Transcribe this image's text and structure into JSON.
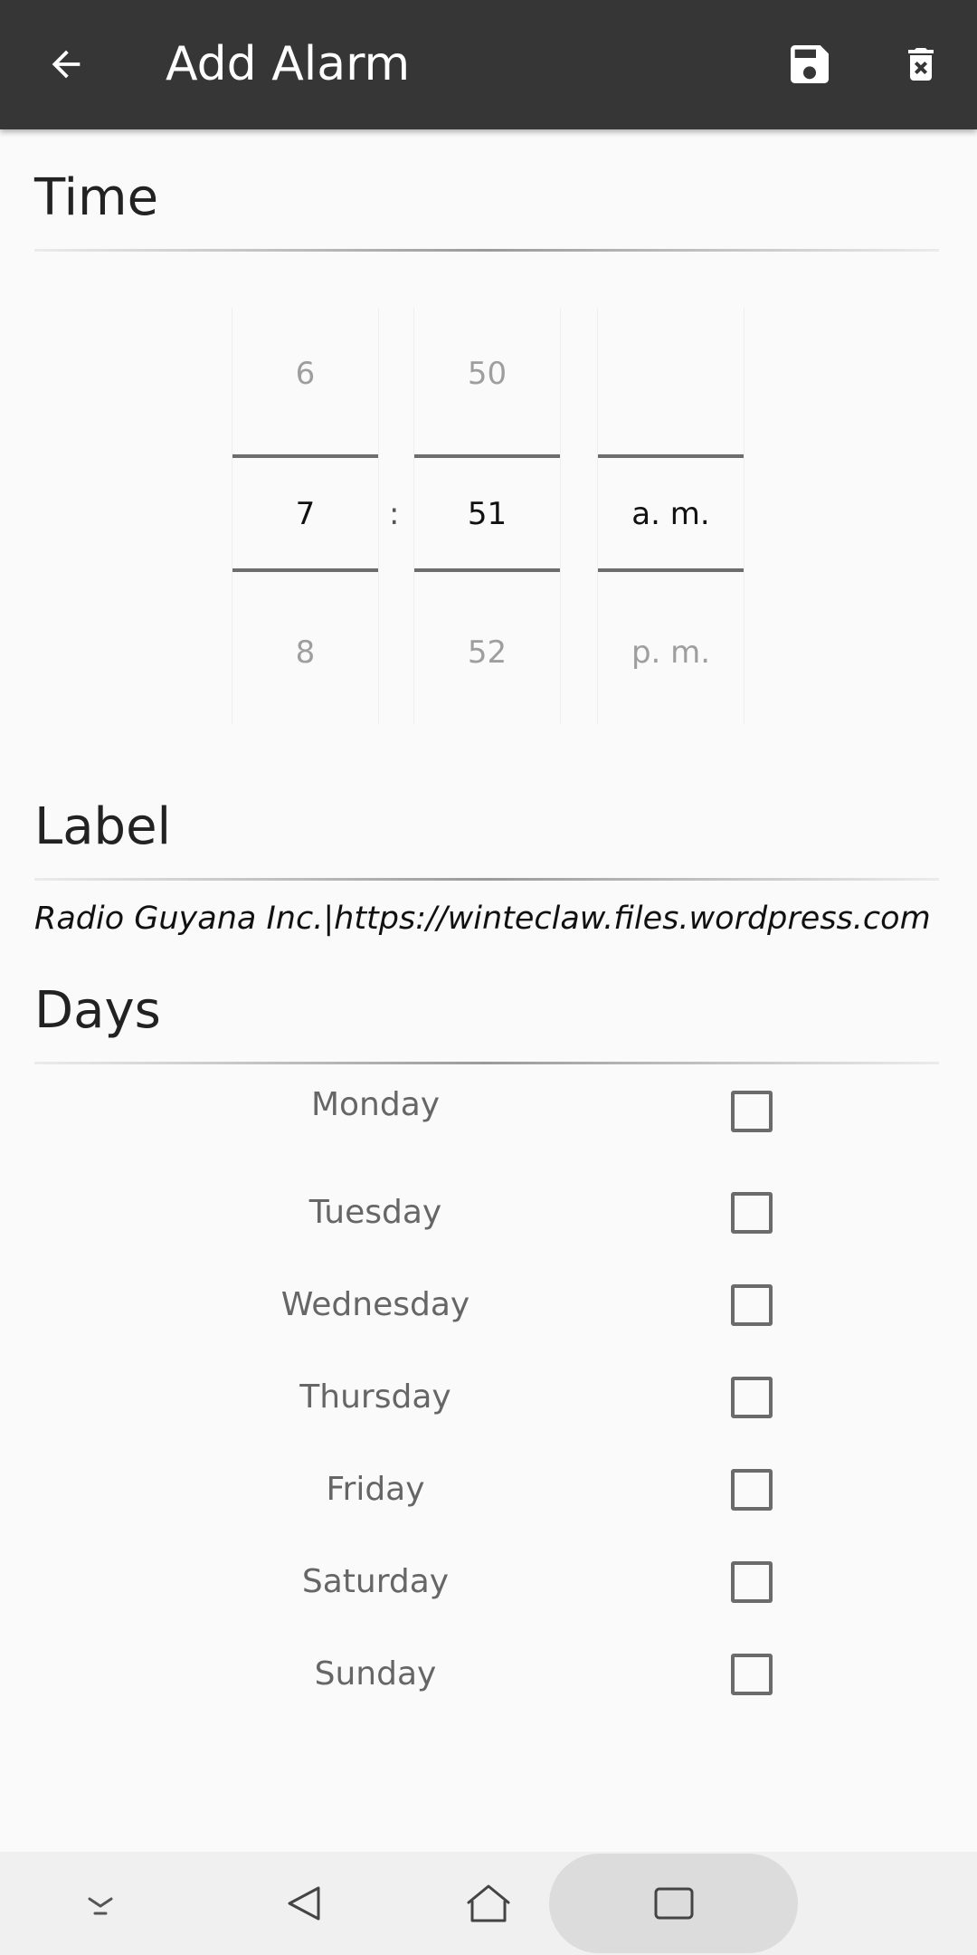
{
  "appbar": {
    "title": "Add Alarm",
    "back_icon": "arrow-back-icon",
    "save_icon": "save-icon",
    "delete_icon": "delete-icon"
  },
  "time": {
    "section_title": "Time",
    "hour": {
      "prev": "6",
      "selected": "7",
      "next": "8"
    },
    "separator": ":",
    "minute": {
      "prev": "50",
      "selected": "51",
      "next": "52"
    },
    "ampm": {
      "prev": "",
      "selected": "a. m.",
      "next": "p. m."
    }
  },
  "label": {
    "section_title": "Label",
    "value": "Radio Guyana Inc.|https://winteclaw.files.wordpress.com"
  },
  "days": {
    "section_title": "Days",
    "items": [
      {
        "name": "Monday",
        "checked": false
      },
      {
        "name": "Tuesday",
        "checked": false
      },
      {
        "name": "Wednesday",
        "checked": false
      },
      {
        "name": "Thursday",
        "checked": false
      },
      {
        "name": "Friday",
        "checked": false
      },
      {
        "name": "Saturday",
        "checked": false
      },
      {
        "name": "Sunday",
        "checked": false
      }
    ]
  },
  "navbar": {
    "icons": [
      "keyboard-hide-icon",
      "back-triangle-icon",
      "home-icon",
      "recents-icon"
    ]
  },
  "colors": {
    "appbar_bg": "#363636",
    "background": "#fafafa",
    "selection_line": "#6d6d6d"
  }
}
